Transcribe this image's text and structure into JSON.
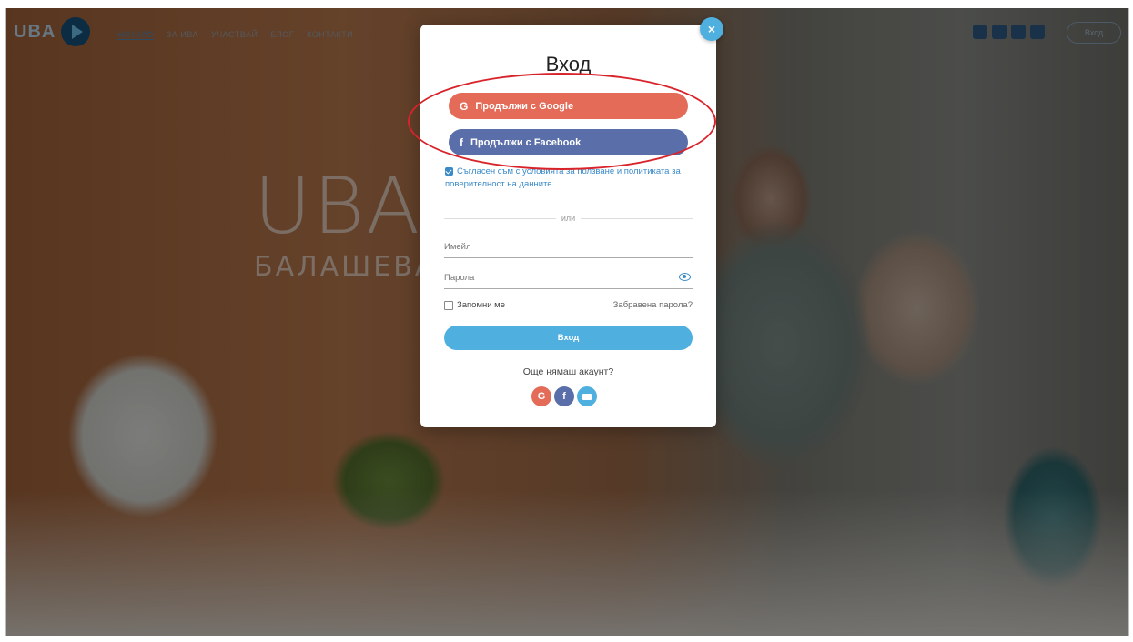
{
  "logo": {
    "text": "UBA"
  },
  "nav": {
    "items": [
      "НАЧАЛО",
      "ЗА ИВА",
      "УЧАСТВАЙ",
      "БЛОГ",
      "КОНТАКТИ"
    ]
  },
  "header": {
    "login_label": "Вход",
    "social_icons": [
      "facebook-icon",
      "youtube-icon",
      "linkedin-icon",
      "instagram-icon"
    ]
  },
  "background": {
    "brand_big": "UBA",
    "brand_sub": "БАЛАШЕВА"
  },
  "modal": {
    "close_symbol": "×",
    "title": "Вход",
    "google_button": "Продължи с Google",
    "facebook_button": "Продължи с Facebook",
    "consent_text": "Съгласен съм с условията за ползване и политиката за поверителност на данните",
    "divider": "или",
    "email_placeholder": "Имейл",
    "password_placeholder": "Парола",
    "remember_label": "Запомни ме",
    "forgot_label": "Забравена парола?",
    "submit_label": "Вход",
    "no_account": "Още нямаш акаунт?"
  },
  "colors": {
    "google": "#e36b57",
    "facebook": "#5a6ea9",
    "accent": "#4fb0e0",
    "annotation": "#d8232a"
  }
}
